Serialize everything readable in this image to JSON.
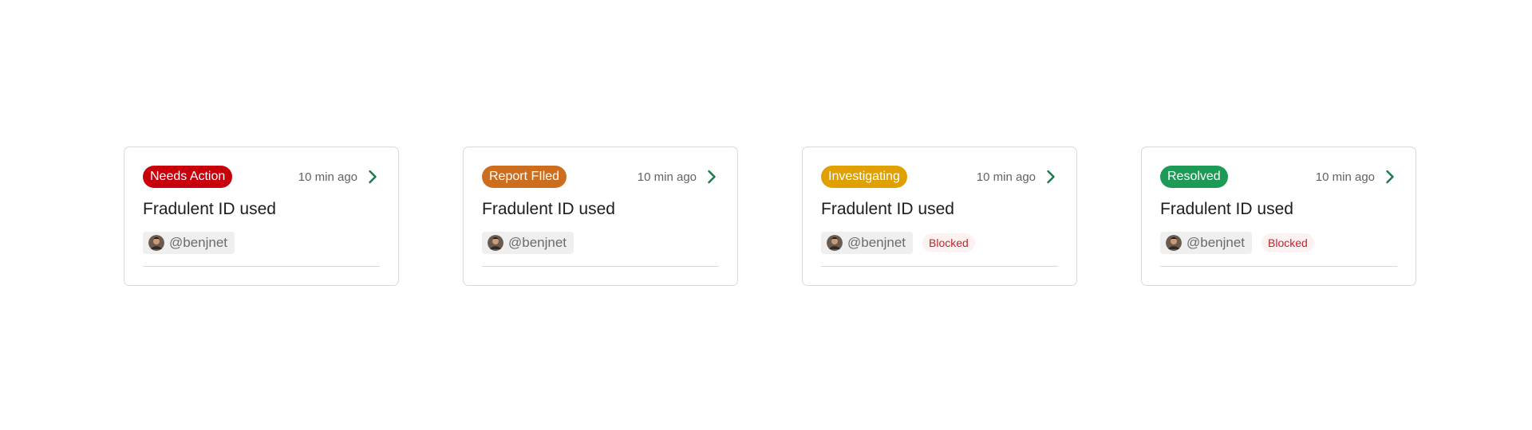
{
  "colors": {
    "needs_action": "#c8000c",
    "report_filed": "#cd6e1f",
    "investigating": "#e0a000",
    "resolved": "#1d9a55",
    "chevron": "#1b7a4a",
    "blocked_text": "#c0232b"
  },
  "cards": [
    {
      "status": "Needs Action",
      "status_color": "#c8000c",
      "time": "10 min ago",
      "title": "Fradulent ID used",
      "user": "@benjnet",
      "tag": ""
    },
    {
      "status": "Report FIled",
      "status_color": "#cd6e1f",
      "time": "10 min ago",
      "title": "Fradulent ID used",
      "user": "@benjnet",
      "tag": ""
    },
    {
      "status": "Investigating",
      "status_color": "#e0a000",
      "time": "10 min ago",
      "title": "Fradulent ID used",
      "user": "@benjnet",
      "tag": "Blocked"
    },
    {
      "status": "Resolved",
      "status_color": "#1d9a55",
      "time": "10 min ago",
      "title": "Fradulent ID used",
      "user": "@benjnet",
      "tag": "Blocked"
    }
  ],
  "icons": {
    "open": "chevron-right-icon",
    "avatar": "user-avatar"
  }
}
